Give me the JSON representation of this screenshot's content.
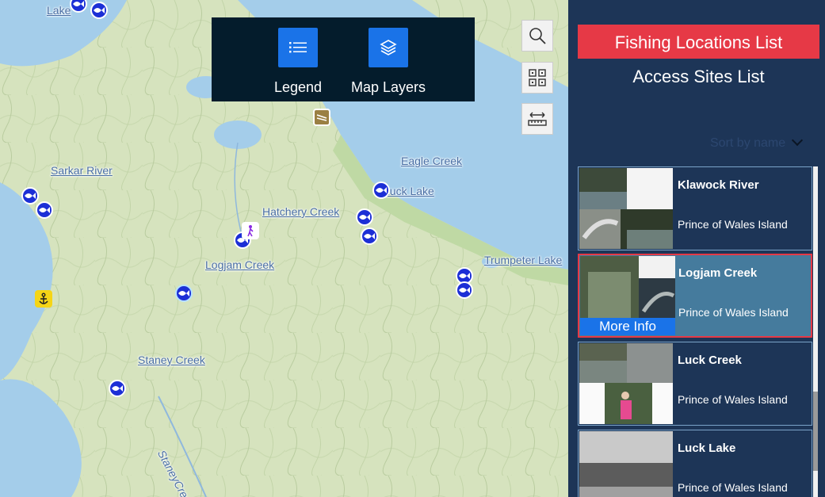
{
  "map": {
    "labels": [
      "Lake",
      "Sarkar River",
      "Eagle Creek",
      "Luck Lake",
      "Hatchery Creek",
      "Logjam Creek",
      "Trumpeter Lake",
      "Staney Creek",
      "StaneyCreek"
    ],
    "tools": {
      "legend_label": "Legend",
      "layers_label": "Map Layers"
    },
    "controls": [
      "search-icon",
      "qr-grid-icon",
      "measure-icon"
    ]
  },
  "sidebar": {
    "fishing_list_label": "Fishing Locations List",
    "access_sites_label": "Access Sites List",
    "sort_label": "Sort by name",
    "more_info_label": "More Info",
    "cards": [
      {
        "title": "Klawock River",
        "subtitle": "Prince of Wales Island"
      },
      {
        "title": "Logjam Creek",
        "subtitle": "Prince of Wales Island"
      },
      {
        "title": "Luck Creek",
        "subtitle": "Prince of Wales Island"
      },
      {
        "title": "Luck Lake",
        "subtitle": "Prince of Wales Island"
      }
    ]
  },
  "colors": {
    "accent": "#e63946",
    "panel": "#1d3557",
    "button_blue": "#1a73e8",
    "marker": "#1c2fd6"
  }
}
